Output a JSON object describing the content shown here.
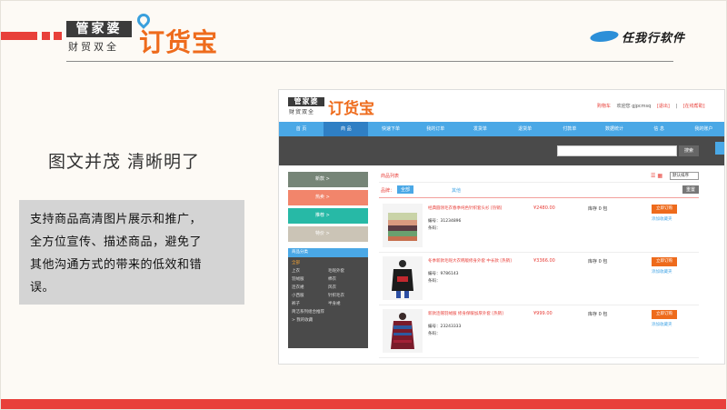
{
  "header": {
    "brand_box": "管家婆",
    "brand_sub": "财贸双全",
    "brand_name": "订货宝",
    "right_logo": "任我行软件"
  },
  "heading": "图文并茂  清晰明了",
  "description": [
    "支持商品高清图片展示和推广，",
    "全方位宣传、描述商品，避免了",
    "其他沟通方式的带来的低效和错",
    "误。"
  ],
  "colors": {
    "accent": "#e8403a",
    "brand_orange": "#ee6b1c",
    "nav_blue": "#4aa8e6"
  },
  "shot": {
    "logo_box": "管家婆",
    "logo_sub": "财贸双全",
    "logo_name": "订货宝",
    "top_links": [
      "购物车",
      "欢迎您 gjpcmsq",
      "[退出]",
      "|",
      "[在线帮助]"
    ],
    "nav": [
      "首 页",
      "商 品",
      "快速下单",
      "我的订单",
      "发货单",
      "退货单",
      "付款单",
      "数据统计",
      "信 息",
      "我的账户"
    ],
    "nav_active_index": 1,
    "search_button": "搜索",
    "categories": [
      "新款 >",
      "热卖 >",
      "推荐 >",
      "特价 >"
    ],
    "classify_title": "商品分类",
    "classify": [
      "全部",
      "",
      "上衣",
      "毛呢外套",
      "羽绒服",
      "棉衣",
      "连衣裙",
      "风衣",
      "小西服",
      "针织毛衣",
      "裤子",
      "半身裙",
      "简洁系列组合推荐",
      "",
      "> 我的收藏",
      ""
    ],
    "list_title": "商品列表",
    "sort_label": "默认排序",
    "filter": {
      "label": "品牌：",
      "selected": "全部",
      "other": "其他",
      "reset": "重置"
    },
    "items": [
      {
        "title": "经典圆领毛衣春季纯色针织套头衫 [热销]",
        "code": "编号：31234896",
        "pic": "条码：",
        "price": "¥2480.00",
        "stock": "库存 0 包",
        "buy": "立即订购",
        "fav": "添加收藏夹"
      },
      {
        "title": "冬季新款毛呢大衣韩版修身外套 中长款 [热销]",
        "code": "编号：9786143",
        "pic": "条码：",
        "price": "¥3366.00",
        "stock": "库存 0 包",
        "buy": "立即订购",
        "fav": "添加收藏夹"
      },
      {
        "title": "新款连帽羽绒服 修身保暖加厚外套 [热销]",
        "code": "编号：23243333",
        "pic": "条码：",
        "price": "¥999.00",
        "stock": "库存 0 包",
        "buy": "立即订购",
        "fav": "添加收藏夹"
      }
    ]
  }
}
